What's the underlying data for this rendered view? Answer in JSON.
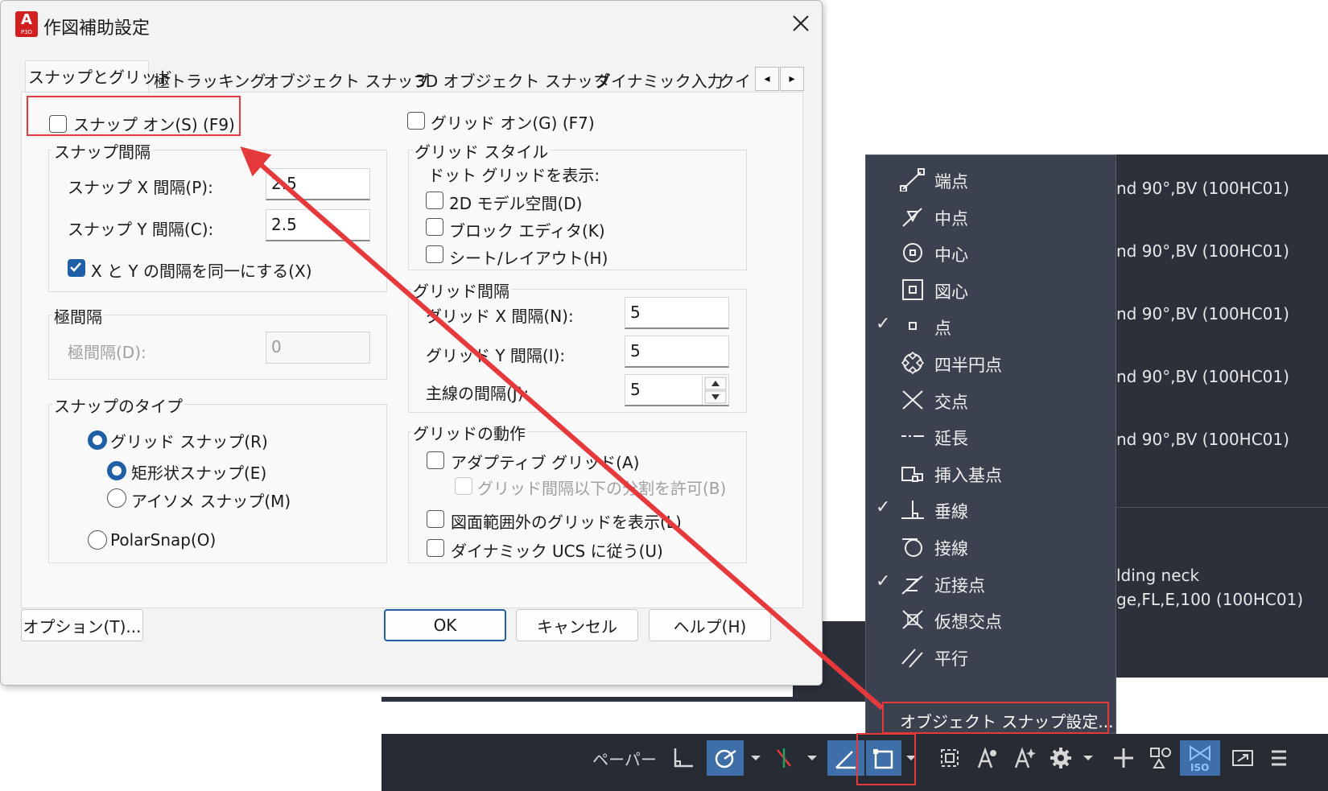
{
  "dialog": {
    "title": "作図補助設定",
    "app_badge": "A",
    "app_badge_sub": "P3D",
    "tabs": [
      "スナップとグリッド",
      "極トラッキング",
      "オブジェクト スナップ",
      "3D オブジェクト スナップ",
      "ダイナミック入力",
      "クイッ"
    ],
    "tab_scroll_left": "◂",
    "tab_scroll_right": "▸",
    "snap_on": {
      "label": "スナップ オン(S) (F9)",
      "checked": false
    },
    "grid_on": {
      "label": "グリッド オン(G) (F7)",
      "checked": false
    },
    "snap_spacing": {
      "title": "スナップ間隔",
      "x_label": "スナップ X 間隔(P):",
      "x_value": "2.5",
      "y_label": "スナップ Y 間隔(C):",
      "y_value": "2.5",
      "equal_label": "X と Y の間隔を同一にする(X)",
      "equal_checked": true
    },
    "polar_spacing": {
      "title": "極間隔",
      "label": "極間隔(D):",
      "value": "0"
    },
    "snap_type": {
      "title": "スナップのタイプ",
      "grid_snap": "グリッド スナップ(R)",
      "rect_snap": "矩形状スナップ(E)",
      "iso_snap": "アイソメ スナップ(M)",
      "polar_snap": "PolarSnap(O)"
    },
    "grid_style": {
      "title": "グリッド スタイル",
      "subtitle": "ドット グリッドを表示:",
      "model": "2D モデル空間(D)",
      "block": "ブロック エディタ(K)",
      "sheet": "シート/レイアウト(H)"
    },
    "grid_spacing": {
      "title": "グリッド間隔",
      "x_label": "グリッド X 間隔(N):",
      "x_value": "5",
      "y_label": "グリッド Y 間隔(I):",
      "y_value": "5",
      "major_label": "主線の間隔(J):",
      "major_value": "5"
    },
    "grid_behavior": {
      "title": "グリッドの動作",
      "adaptive": "アダプティブ グリッド(A)",
      "subdivide": "グリッド間隔以下の分割を許可(B)",
      "beyond_limits": "図面範囲外のグリッドを表示(L)",
      "follow_ucs": "ダイナミック UCS に従う(U)"
    },
    "buttons": {
      "options": "オプション(T)...",
      "ok": "OK",
      "cancel": "キャンセル",
      "help": "ヘルプ(H)"
    }
  },
  "background_list": {
    "rows": [
      "nd 90°,BV (100HC01)",
      "nd 90°,BV (100HC01)",
      "nd 90°,BV (100HC01)",
      "nd 90°,BV (100HC01)",
      "nd 90°,BV (100HC01)",
      "lding neck",
      "ge,FL,E,100 (100HC01)"
    ]
  },
  "osnap_menu": {
    "items": [
      {
        "label": "端点",
        "checked": false,
        "icon": "endpoint-icon"
      },
      {
        "label": "中点",
        "checked": false,
        "icon": "midpoint-icon"
      },
      {
        "label": "中心",
        "checked": false,
        "icon": "center-icon"
      },
      {
        "label": "図心",
        "checked": false,
        "icon": "centroid-icon"
      },
      {
        "label": "点",
        "checked": true,
        "icon": "node-icon"
      },
      {
        "label": "四半円点",
        "checked": false,
        "icon": "quadrant-icon"
      },
      {
        "label": "交点",
        "checked": false,
        "icon": "intersection-icon"
      },
      {
        "label": "延長",
        "checked": false,
        "icon": "extension-icon"
      },
      {
        "label": "挿入基点",
        "checked": false,
        "icon": "insertion-icon"
      },
      {
        "label": "垂線",
        "checked": true,
        "icon": "perpendicular-icon"
      },
      {
        "label": "接線",
        "checked": false,
        "icon": "tangent-icon"
      },
      {
        "label": "近接点",
        "checked": true,
        "icon": "nearest-icon"
      },
      {
        "label": "仮想交点",
        "checked": false,
        "icon": "apparent-intersection-icon"
      },
      {
        "label": "平行",
        "checked": false,
        "icon": "parallel-icon"
      }
    ],
    "settings_label": "オブジェクト スナップ設定...",
    "check_glyph": "✓"
  },
  "status_bar": {
    "paper_label": "ペーパー",
    "iso_label": "ISO"
  },
  "colors": {
    "highlight_red": "#e5393b",
    "accent_blue": "#1f5fa8",
    "menu_bg": "#3b414e"
  }
}
